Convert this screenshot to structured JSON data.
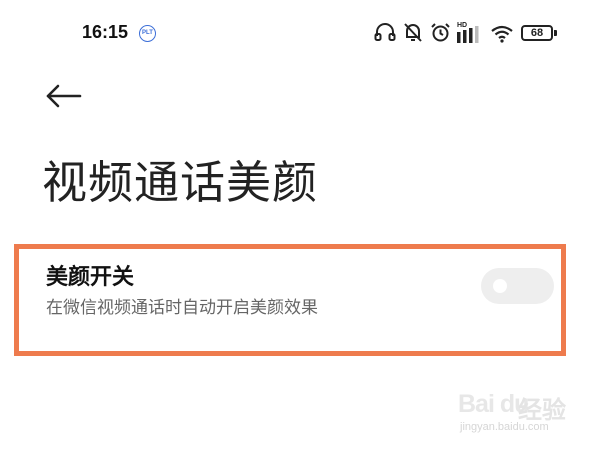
{
  "status_bar": {
    "time": "16:15",
    "notification_badge": "PLT",
    "network_label": "HD",
    "battery": "68",
    "icons": [
      "headset-icon",
      "bell-off-icon",
      "alarm-icon",
      "signal-icon",
      "wifi-icon",
      "battery-icon"
    ]
  },
  "header": {
    "back_icon": "arrow-left-icon",
    "title": "视频通话美颜"
  },
  "setting": {
    "title": "美颜开关",
    "description": "在微信视频通话时自动开启美颜效果",
    "toggle_on": false,
    "highlight_color": "#ee7b4d"
  },
  "watermark": {
    "logo": "Bai du",
    "brand": "经验",
    "url": "jingyan.baidu.com"
  }
}
